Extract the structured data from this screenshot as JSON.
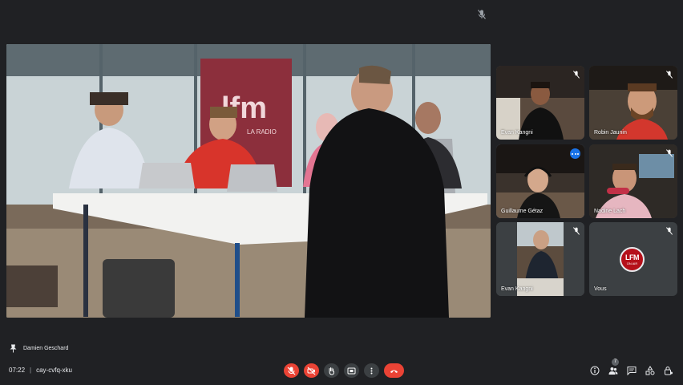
{
  "main_feed": {
    "sign_brand": "lfm",
    "sign_sub": "LA RADIO"
  },
  "tiles": [
    {
      "name": "Evan Kangni",
      "muted": true
    },
    {
      "name": "Robin Jaunin",
      "muted": true
    },
    {
      "name": "Guillaume Gétaz",
      "muted": false,
      "active": true
    },
    {
      "name": "Nadine Lach",
      "muted": true
    },
    {
      "name": "Evan Kangni",
      "muted": true
    },
    {
      "name": "Vous",
      "muted": true,
      "logo_line1": "LFM",
      "logo_line2": "ON AIR"
    }
  ],
  "presenter": {
    "name": "Damien Geschard"
  },
  "meeting": {
    "time": "07:22",
    "separator": "|",
    "code": "cay-cvfq-xku"
  },
  "controls": [
    "mic-off",
    "camera-off",
    "raise-hand",
    "present",
    "more-options",
    "leave-call"
  ],
  "right_panel": {
    "participants_count": "7"
  },
  "colors": {
    "background": "#202124",
    "danger": "#ea4335",
    "accent": "#1a73e8",
    "active_outline": "#8ab4f8"
  }
}
